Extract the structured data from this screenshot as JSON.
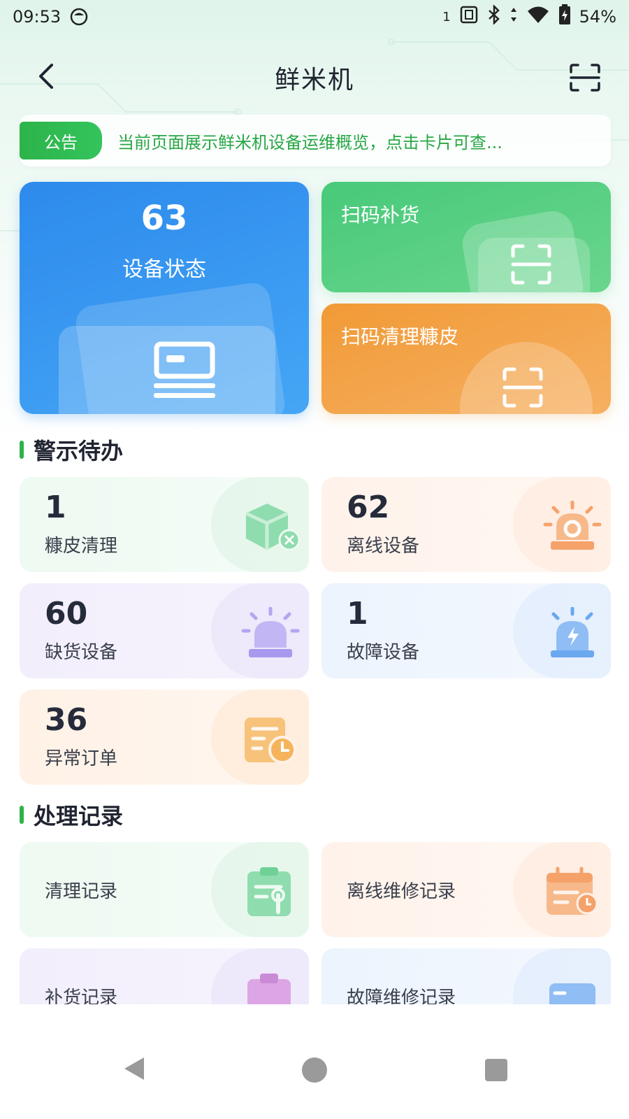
{
  "status_bar": {
    "time": "09:53",
    "sim_slot": "1",
    "battery": "54%",
    "icons": [
      "face-icon",
      "nfc-icon",
      "bluetooth-icon",
      "data-arrows-icon",
      "wifi-icon",
      "battery-icon"
    ]
  },
  "header": {
    "title": "鲜米机",
    "back_icon": "chevron-left-icon",
    "scan_icon": "scan-icon"
  },
  "notice": {
    "tag": "公告",
    "text": "当前页面展示鲜米机设备运维概览，点击卡片可查..."
  },
  "main_cards": {
    "device_status": {
      "value": "63",
      "label": "设备状态",
      "icon": "device-icon"
    },
    "scan_restock": {
      "label": "扫码补货",
      "icon": "scan-icon"
    },
    "scan_clean_bran": {
      "label": "扫码清理糠皮",
      "icon": "scan-icon"
    }
  },
  "alerts": {
    "title": "警示待办",
    "items": [
      {
        "value": "1",
        "label": "糠皮清理",
        "icon": "box-cross-icon",
        "color": "#6fd196"
      },
      {
        "value": "62",
        "label": "离线设备",
        "icon": "alarm-light-icon",
        "color": "#f5a26a"
      },
      {
        "value": "60",
        "label": "缺货设备",
        "icon": "siren-icon",
        "color": "#a898ee"
      },
      {
        "value": "1",
        "label": "故障设备",
        "icon": "fault-siren-icon",
        "color": "#6aa8f0"
      },
      {
        "value": "36",
        "label": "异常订单",
        "icon": "order-clock-icon",
        "color": "#f5b45c"
      }
    ]
  },
  "records": {
    "title": "处理记录",
    "items": [
      {
        "label": "清理记录",
        "icon": "clipboard-wrench-icon",
        "color": "#6fd196"
      },
      {
        "label": "离线维修记录",
        "icon": "calendar-clock-icon",
        "color": "#f5a26a"
      },
      {
        "label": "补货记录",
        "icon": "clipboard-icon",
        "color": "#c98bd6"
      },
      {
        "label": "故障维修记录",
        "icon": "repair-icon",
        "color": "#6aa8f0"
      }
    ]
  },
  "nav_bar": {
    "back": "nav-back-icon",
    "home": "nav-home-icon",
    "recent": "nav-recent-icon"
  }
}
